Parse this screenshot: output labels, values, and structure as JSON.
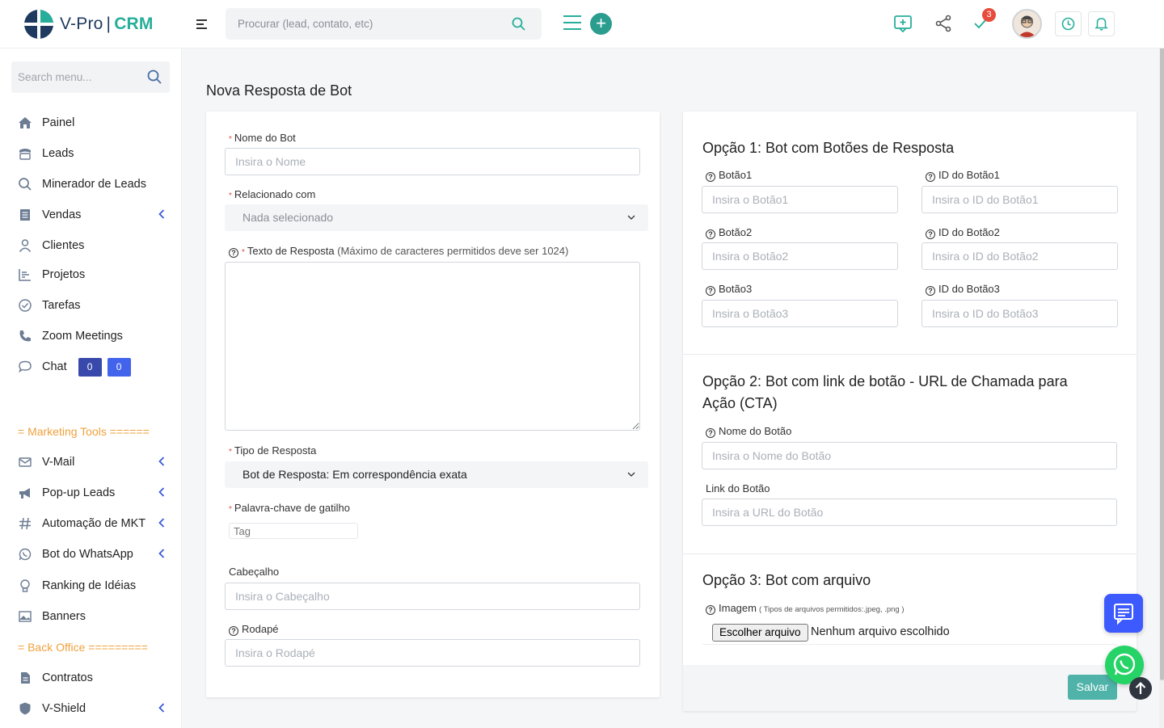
{
  "brand": {
    "name": "V-Pro",
    "sep": "|",
    "crm": "CRM"
  },
  "header": {
    "search_placeholder": "Procurar (lead, contato, etc)",
    "badge_count": "3",
    "colors": {
      "accent": "#27ae9a",
      "badge": "#e74c3c"
    }
  },
  "sidebar": {
    "search_placeholder": "Search menu...",
    "items": [
      {
        "label": "Painel",
        "icon": "home-icon"
      },
      {
        "label": "Leads",
        "icon": "leads-icon"
      },
      {
        "label": "Minerador de Leads",
        "icon": "search-icon"
      },
      {
        "label": "Vendas",
        "icon": "receipt-icon"
      },
      {
        "label": "Clientes",
        "icon": "user-icon"
      },
      {
        "label": "Projetos",
        "icon": "chart-icon"
      },
      {
        "label": "Tarefas",
        "icon": "check-circle-icon"
      },
      {
        "label": "Zoom Meetings",
        "icon": "phone-icon"
      },
      {
        "label": "Chat",
        "icon": "chat-icon"
      }
    ],
    "chat_badges": [
      "0",
      "0"
    ],
    "section_marketing": "= Marketing Tools ======",
    "marketing_items": [
      {
        "label": "V-Mail",
        "icon": "mail-icon"
      },
      {
        "label": "Pop-up Leads",
        "icon": "megaphone-icon"
      },
      {
        "label": "Automação de MKT",
        "icon": "hash-icon"
      },
      {
        "label": "Bot do WhatsApp",
        "icon": "whatsapp-icon"
      },
      {
        "label": "Ranking de Idéias",
        "icon": "bulb-icon"
      },
      {
        "label": "Banners",
        "icon": "image-icon"
      }
    ],
    "section_backoffice": "= Back Office =========",
    "backoffice_items": [
      {
        "label": "Contratos",
        "icon": "document-icon"
      },
      {
        "label": "V-Shield",
        "icon": "shield-icon"
      }
    ]
  },
  "page": {
    "title": "Nova Resposta de Bot",
    "left": {
      "bot_name_label": "Nome do Bot",
      "bot_name_placeholder": "Insira o Nome",
      "related_label": "Relacionado com",
      "related_value": "Nada selecionado",
      "reply_text_label": "Texto de Resposta",
      "reply_text_hint": "(Máximo de caracteres permitidos deve ser 1024)",
      "reply_type_label": "Tipo de Resposta",
      "reply_type_value": "Bot de Resposta: Em correspondência exata",
      "trigger_label": "Palavra-chave de gatilho",
      "trigger_placeholder": "Tag",
      "header_label": "Cabeçalho",
      "header_placeholder": "Insira o Cabeçalho",
      "footer_label": "Rodapé",
      "footer_placeholder": "Insira o Rodapé"
    },
    "right": {
      "opt1_title": "Opção 1: Bot com Botões de Resposta",
      "buttons": [
        {
          "label": "Botão1",
          "placeholder": "Insira o Botão1",
          "id_label": "ID do Botão1",
          "id_placeholder": "Insira o ID do Botão1"
        },
        {
          "label": "Botão2",
          "placeholder": "Insira o Botão2",
          "id_label": "ID do Botão2",
          "id_placeholder": "Insira o ID do Botão2"
        },
        {
          "label": "Botão3",
          "placeholder": "Insira o Botão3",
          "id_label": "ID do Botão3",
          "id_placeholder": "Insira o ID do Botão3"
        }
      ],
      "opt2_title_line1": "Opção 2: Bot com link de botão - URL de Chamada para",
      "opt2_title_line2": "Ação (CTA)",
      "btn_name_label": "Nome do Botão",
      "btn_name_placeholder": "Insira o Nome do Botão",
      "btn_link_label": "Link do Botão",
      "btn_link_placeholder": "Insira a URL do Botão",
      "opt3_title": "Opção 3: Bot com arquivo",
      "image_label": "Imagem",
      "image_hint": "( Tipos de arquivos permitidos:.jpeg, .png )",
      "file_button": "Escolher arquivo",
      "file_status": "Nenhum arquivo escolhido",
      "save_label": "Salvar"
    }
  }
}
